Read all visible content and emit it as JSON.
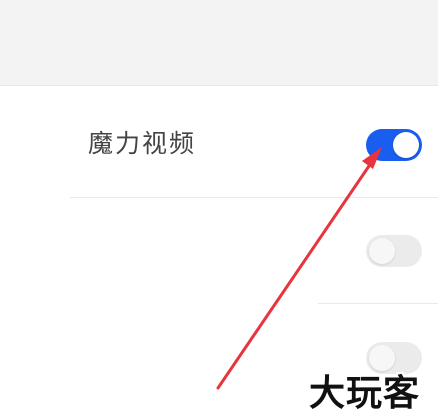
{
  "settings": {
    "items": [
      {
        "label": "魔力视频",
        "enabled": true
      },
      {
        "label": "",
        "enabled": false
      },
      {
        "label": "",
        "enabled": false
      }
    ]
  },
  "watermark": {
    "text": "大玩客"
  },
  "colors": {
    "switch_on": "#1a5ef0",
    "switch_off": "#ebebeb",
    "arrow": "#e8343c",
    "header_bg": "#f3f3f3"
  }
}
